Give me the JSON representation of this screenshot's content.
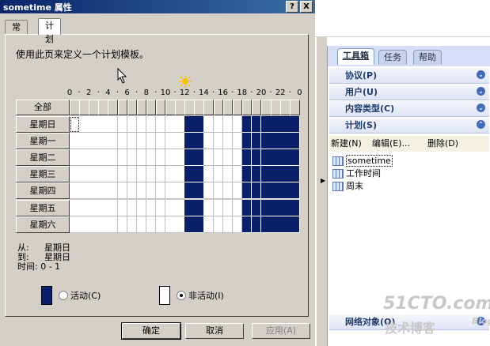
{
  "dialog": {
    "title": "sometime 属性",
    "help_btn": "?",
    "close_btn": "X",
    "tabs": [
      {
        "label": "常规"
      },
      {
        "label": "计划"
      }
    ],
    "description": "使用此页来定义一个计划模板。",
    "hour_ticks": [
      "0",
      "2",
      "4",
      "6",
      "8",
      "10",
      "12",
      "14",
      "16",
      "18",
      "20",
      "22",
      "0"
    ],
    "all_label": "全部",
    "days": [
      "星期日",
      "星期一",
      "星期二",
      "星期三",
      "星期四",
      "星期五",
      "星期六"
    ],
    "active_hours": [
      12,
      13,
      18,
      19,
      20,
      21,
      22,
      23
    ],
    "from_label": "从:",
    "from_value": "星期日",
    "to_label": "到:",
    "to_value": "星期日",
    "time_label": "时间:",
    "time_value": "0 - 1",
    "active_radio": "活动(C)",
    "inactive_radio": "非活动(I)",
    "ok": "确定",
    "cancel": "取消",
    "apply": "应用(A)",
    "colors": {
      "active": "#0a1f6a",
      "inactive": "#ffffff"
    }
  },
  "panel": {
    "tabs": [
      {
        "label": "工具箱"
      },
      {
        "label": "任务"
      },
      {
        "label": "帮助"
      }
    ],
    "sections": [
      {
        "label": "协议(P)"
      },
      {
        "label": "用户(U)"
      },
      {
        "label": "内容类型(C)"
      },
      {
        "label": "计划(S)"
      }
    ],
    "toolbar": {
      "new": "新建(N)",
      "edit": "编辑(E)...",
      "delete": "删除(D)"
    },
    "schedules": [
      {
        "label": "sometime"
      },
      {
        "label": "工作时间"
      },
      {
        "label": "周末"
      }
    ],
    "bottom_section": "网络对象(O)"
  },
  "watermark": {
    "main": "51CTO.com",
    "sub": "技术博客",
    "blog": "Blog"
  }
}
